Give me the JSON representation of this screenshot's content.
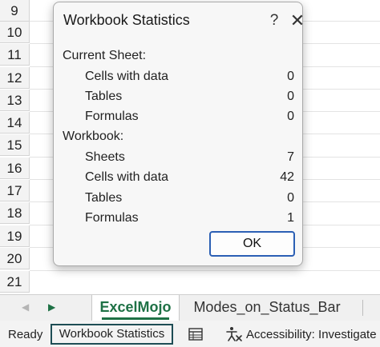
{
  "row_numbers": [
    "9",
    "10",
    "11",
    "12",
    "13",
    "14",
    "15",
    "16",
    "17",
    "18",
    "19",
    "20",
    "21"
  ],
  "dialog": {
    "title": "Workbook Statistics",
    "help_glyph": "?",
    "close_glyph": "✕",
    "current_sheet_label": "Current Sheet:",
    "current_sheet": [
      {
        "label": "Cells with data",
        "value": "0"
      },
      {
        "label": "Tables",
        "value": "0"
      },
      {
        "label": "Formulas",
        "value": "0"
      }
    ],
    "workbook_label": "Workbook:",
    "workbook": [
      {
        "label": "Sheets",
        "value": "7"
      },
      {
        "label": "Cells with data",
        "value": "42"
      },
      {
        "label": "Tables",
        "value": "0"
      },
      {
        "label": "Formulas",
        "value": "1"
      }
    ],
    "ok_label": "OK"
  },
  "tabs": {
    "prev_glyph": "◀",
    "next_glyph": "▶",
    "active": "ExcelMojo",
    "inactive": "Modes_on_Status_Bar"
  },
  "status": {
    "ready": "Ready",
    "workbook_stats": "Workbook Statistics",
    "accessibility": "Accessibility: Investigate"
  },
  "colors": {
    "accent_green": "#1e7145",
    "ok_border": "#2b5fb4"
  }
}
